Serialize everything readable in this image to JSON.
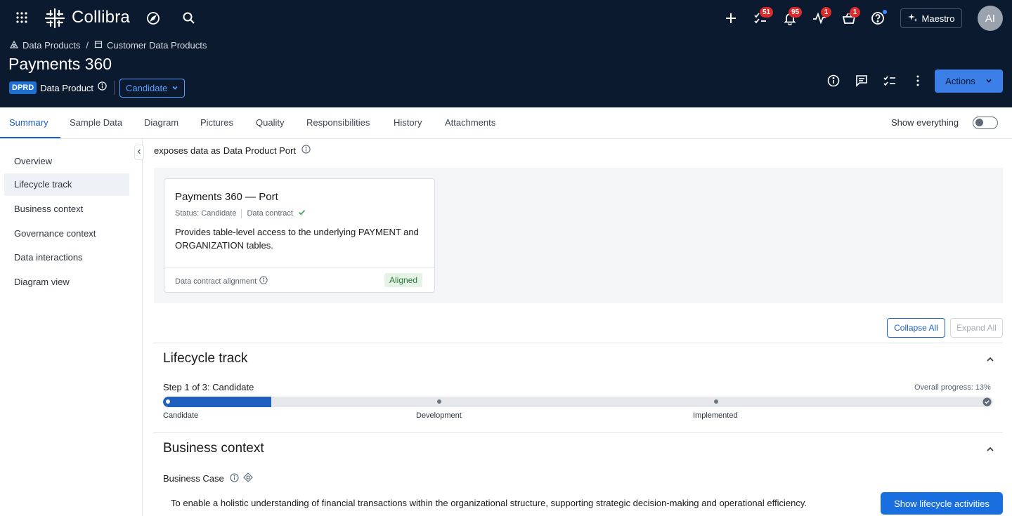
{
  "app": {
    "logo": "Collibra",
    "badges": {
      "tasks": "51",
      "notifications": "95",
      "activity": "1",
      "basket": "1"
    },
    "maestro_label": "Maestro",
    "avatar_initials": "AI"
  },
  "breadcrumb": {
    "items": [
      "Data Products",
      "Customer Data Products"
    ],
    "separator": "/"
  },
  "asset": {
    "title": "Payments 360",
    "type_code": "DPRD",
    "type_label": "Data Product",
    "status": "Candidate",
    "actions_label": "Actions"
  },
  "tabs": [
    "Summary",
    "Sample Data",
    "Diagram",
    "Pictures",
    "Quality",
    "Responsibilities",
    "History",
    "Attachments"
  ],
  "show_everything_label": "Show everything",
  "sidebar": {
    "items": [
      "Overview",
      "Lifecycle track",
      "Business context",
      "Governance context",
      "Data interactions",
      "Diagram view"
    ],
    "active_index": 1
  },
  "exposes": {
    "prefix": "exposes data as",
    "target": "Data Product Port"
  },
  "port_card": {
    "title": "Payments 360 — Port",
    "status": "Status: Candidate",
    "contract": "Data contract",
    "description": "Provides table-level access to the underlying PAYMENT and ORGANIZATION tables.",
    "alignment_label": "Data contract alignment",
    "alignment_value": "Aligned"
  },
  "buttons": {
    "collapse_all": "Collapse All",
    "expand_all": "Expand All"
  },
  "lifecycle": {
    "title": "Lifecycle track",
    "step_text": "Step 1 of 3: Candidate",
    "progress_text": "Overall progress: 13%",
    "progress_fraction": 0.13,
    "stages": [
      "Candidate",
      "Development",
      "Implemented"
    ]
  },
  "business_context": {
    "title": "Business context",
    "case_label": "Business Case",
    "case_text": "To enable a holistic understanding of financial transactions within the organizational structure, supporting strategic decision-making and operational efficiency.",
    "lifecycle_button": "Show lifecycle activities"
  },
  "colors": {
    "header_bg": "#0b1a2e",
    "accent": "#1f5fbf",
    "badge": "#d92c2c",
    "aligned_bg": "#e4f3e6"
  }
}
